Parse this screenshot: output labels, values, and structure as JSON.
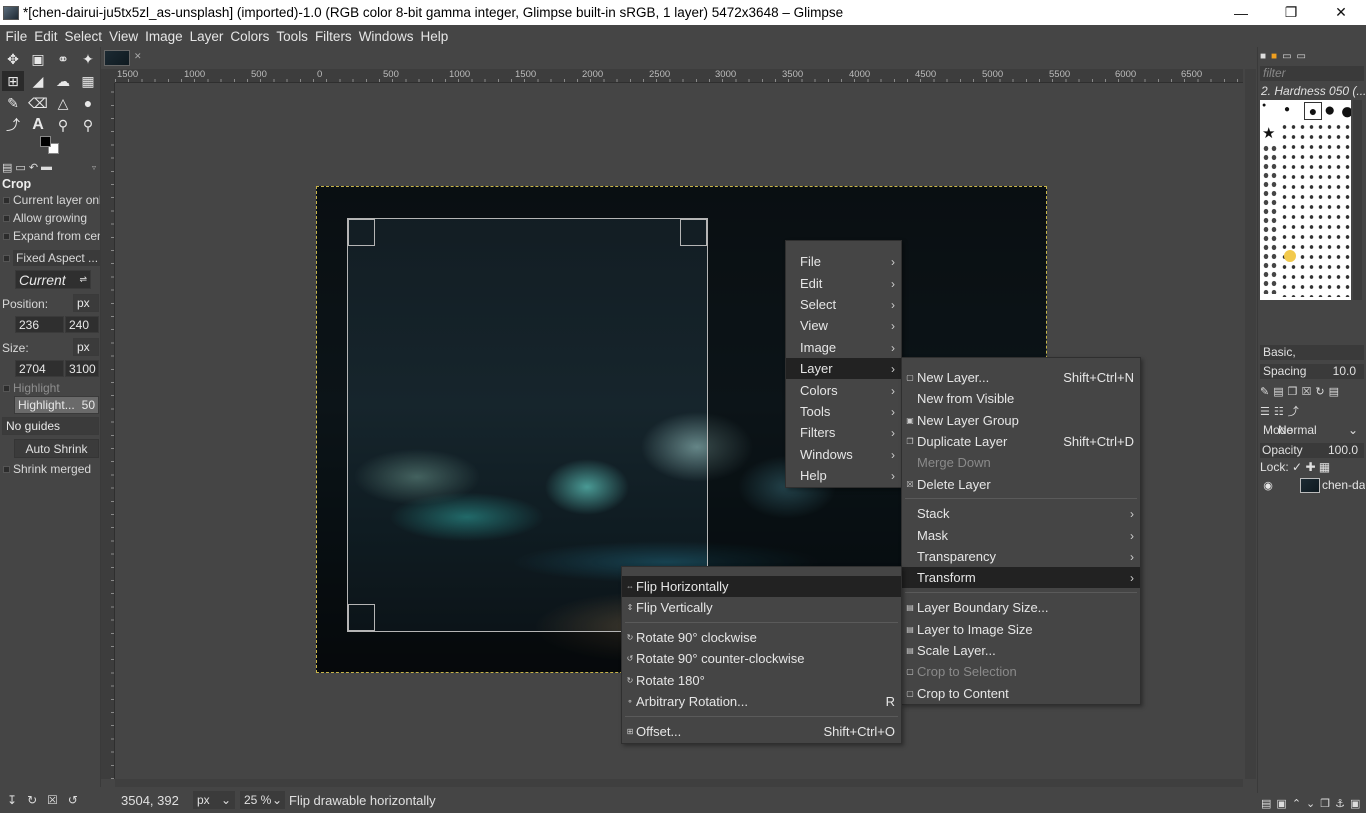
{
  "window": {
    "title": "*[chen-dairui-ju5tx5zl_as-unsplash] (imported)-1.0 (RGB color 8-bit gamma integer, Glimpse built-in sRGB, 1 layer) 5472x3648 – Glimpse",
    "minimize_icon": "minimize-icon",
    "maximize_icon": "restore-icon",
    "close_icon": "close-icon"
  },
  "menubar": [
    "File",
    "Edit",
    "Select",
    "View",
    "Image",
    "Layer",
    "Colors",
    "Tools",
    "Filters",
    "Windows",
    "Help"
  ],
  "ruler_labels": [
    "1500",
    "1000",
    "500",
    "0",
    "500",
    "1000",
    "1500",
    "2000",
    "2500",
    "3000",
    "3500",
    "4000",
    "4500",
    "5000",
    "5500",
    "6000",
    "6500"
  ],
  "tool_options": {
    "title": "Crop",
    "current_layer_only": "Current layer onl",
    "allow_growing": "Allow growing",
    "expand_from_center": "Expand from cen",
    "fixed_aspect": "Fixed Aspect ...",
    "aspect_current": "Current",
    "position_label": "Position:",
    "position_unit": "px",
    "position_x": "236",
    "position_y": "240",
    "size_label": "Size:",
    "size_unit": "px",
    "size_w": "2704",
    "size_h": "3100",
    "highlight": "Highlight",
    "highlight_opacity_label": "Highlight...",
    "highlight_opacity_value": "50",
    "guides": "No guides",
    "auto_shrink": "Auto Shrink",
    "shrink_merged": "Shrink merged"
  },
  "context_menu": {
    "items": [
      {
        "label": "File"
      },
      {
        "label": "Edit"
      },
      {
        "label": "Select"
      },
      {
        "label": "View"
      },
      {
        "label": "Image"
      },
      {
        "label": "Layer"
      },
      {
        "label": "Colors"
      },
      {
        "label": "Tools"
      },
      {
        "label": "Filters"
      },
      {
        "label": "Windows"
      },
      {
        "label": "Help"
      }
    ]
  },
  "layer_menu": {
    "new_layer": "New Layer...",
    "new_layer_acc": "Shift+Ctrl+N",
    "new_from_visible": "New from Visible",
    "new_layer_group": "New Layer Group",
    "duplicate_layer": "Duplicate Layer",
    "duplicate_layer_acc": "Shift+Ctrl+D",
    "merge_down": "Merge Down",
    "delete_layer": "Delete Layer",
    "stack": "Stack",
    "mask": "Mask",
    "transparency": "Transparency",
    "transform": "Transform",
    "layer_boundary_size": "Layer Boundary Size...",
    "layer_to_image_size": "Layer to Image Size",
    "scale_layer": "Scale Layer...",
    "crop_to_selection": "Crop to Selection",
    "crop_to_content": "Crop to Content"
  },
  "transform_menu": {
    "flip_h": "Flip Horizontally",
    "flip_v": "Flip Vertically",
    "rot_cw": "Rotate 90° clockwise",
    "rot_ccw": "Rotate 90° counter-clockwise",
    "rot_180": "Rotate 180°",
    "arbitrary": "Arbitrary Rotation...",
    "arbitrary_acc": "R",
    "offset": "Offset...",
    "offset_acc": "Shift+Ctrl+O"
  },
  "dock": {
    "filter_placeholder": "filter",
    "brush_name": "2. Hardness 050 (...",
    "preset": "Basic,",
    "spacing_label": "Spacing",
    "spacing_value": "10.0",
    "mode_label": "Mode",
    "mode_value": "Normal",
    "opacity_label": "Opacity",
    "opacity_value": "100.0",
    "lock_label": "Lock:",
    "layer_name": "chen-da"
  },
  "statusbar": {
    "coords": "3504, 392",
    "unit": "px",
    "zoom": "25 %",
    "message": "Flip drawable horizontally"
  },
  "colors": {
    "bg": "#454545",
    "highlight": "#222222",
    "image_border": "#c8b44a"
  }
}
